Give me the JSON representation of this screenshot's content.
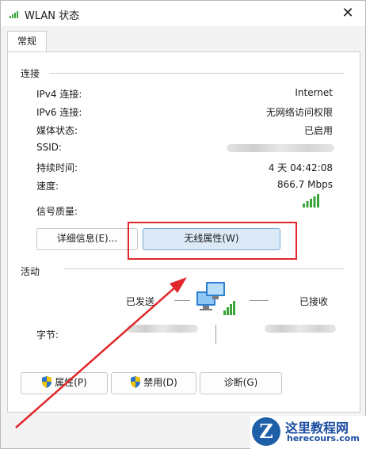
{
  "window": {
    "title": "WLAN 状态",
    "close_glyph": "✕"
  },
  "tabs": [
    {
      "label": "常规"
    }
  ],
  "connection": {
    "title": "连接",
    "rows": [
      {
        "label": "IPv4 连接:",
        "value": "Internet"
      },
      {
        "label": "IPv6 连接:",
        "value": "无网络访问权限"
      },
      {
        "label": "媒体状态:",
        "value": "已启用"
      },
      {
        "label": "SSID:",
        "value": ""
      },
      {
        "label": "持续时间:",
        "value": "4 天 04:42:08"
      },
      {
        "label": "速度:",
        "value": "866.7 Mbps"
      }
    ],
    "signal_label": "信号质量:",
    "signal_bars": 5,
    "details_button": "详细信息(E)...",
    "wireless_button": "无线属性(W)"
  },
  "activity": {
    "title": "活动",
    "sent_label": "已发送",
    "received_label": "已接收",
    "bytes_label": "字节:"
  },
  "buttons": {
    "properties": "属性(P)",
    "disable": "禁用(D)",
    "diagnose": "诊断(G)"
  },
  "watermark": {
    "cn": "这里教程网",
    "en": "herecours.com"
  },
  "colors": {
    "accent_blue": "#dceaf7",
    "highlight_red": "#e0282c",
    "signal_green": "#3aa53a"
  },
  "icons": [
    "wifi-icon",
    "close-icon",
    "signal-strength-icon",
    "network-computers-icon",
    "shield-icon"
  ]
}
